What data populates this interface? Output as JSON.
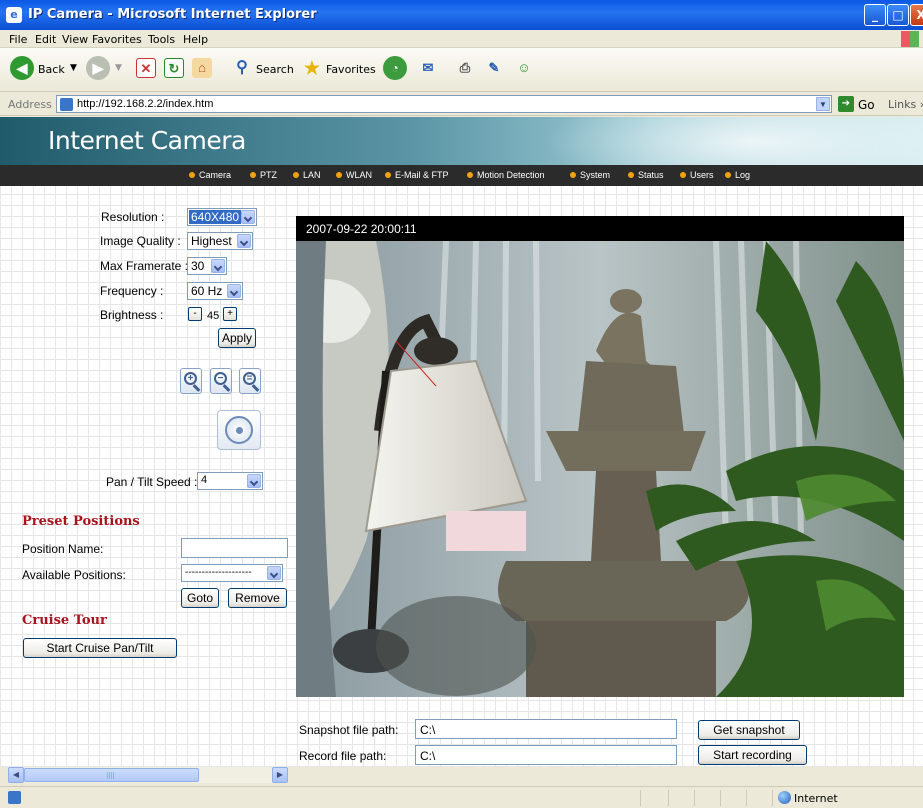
{
  "window": {
    "title": "IP Camera - Microsoft Internet Explorer",
    "min_glyph": "_",
    "max_glyph": "□",
    "close_glyph": "X"
  },
  "menu": [
    "File",
    "Edit",
    "View",
    "Favorites",
    "Tools",
    "Help"
  ],
  "toolbar": {
    "back": "Back",
    "search": "Search",
    "favorites": "Favorites"
  },
  "address": {
    "label": "Address",
    "url": "http://192.168.2.2/index.htm",
    "go": "Go",
    "links": "Links »"
  },
  "banner": {
    "title": "Internet Camera"
  },
  "nav": [
    "Camera",
    "PTZ",
    "LAN",
    "WLAN",
    "E-Mail & FTP",
    "Motion Detection",
    "System",
    "Status",
    "Users",
    "Log"
  ],
  "settings": {
    "resolution": {
      "label": "Resolution :",
      "value": "640X480"
    },
    "quality": {
      "label": "Image Quality :",
      "value": "Highest"
    },
    "framerate": {
      "label": "Max Framerate :",
      "value": "30"
    },
    "frequency": {
      "label": "Frequency :",
      "value": "60 Hz"
    },
    "brightness": {
      "label": "Brightness :",
      "value": "45",
      "minus": "-",
      "plus": "+"
    },
    "apply": "Apply"
  },
  "ptz": {
    "speed_label": "Pan / Tilt Speed :",
    "speed_value": "4"
  },
  "preset": {
    "title": "Preset Positions",
    "name_label": "Position Name:",
    "name_value": "",
    "available_label": "Available Positions:",
    "available_value": "--------------------",
    "goto": "Goto",
    "remove": "Remove"
  },
  "cruise": {
    "title": "Cruise Tour",
    "start": "Start Cruise Pan/Tilt"
  },
  "video": {
    "timestamp": "2007-09-22 20:00:11"
  },
  "snapshot": {
    "label": "Snapshot file path:",
    "value": "C:\\",
    "button": "Get snapshot"
  },
  "record": {
    "label": "Record file path:",
    "value": "C:\\",
    "button": "Start recording"
  },
  "status": {
    "zone": "Internet"
  }
}
